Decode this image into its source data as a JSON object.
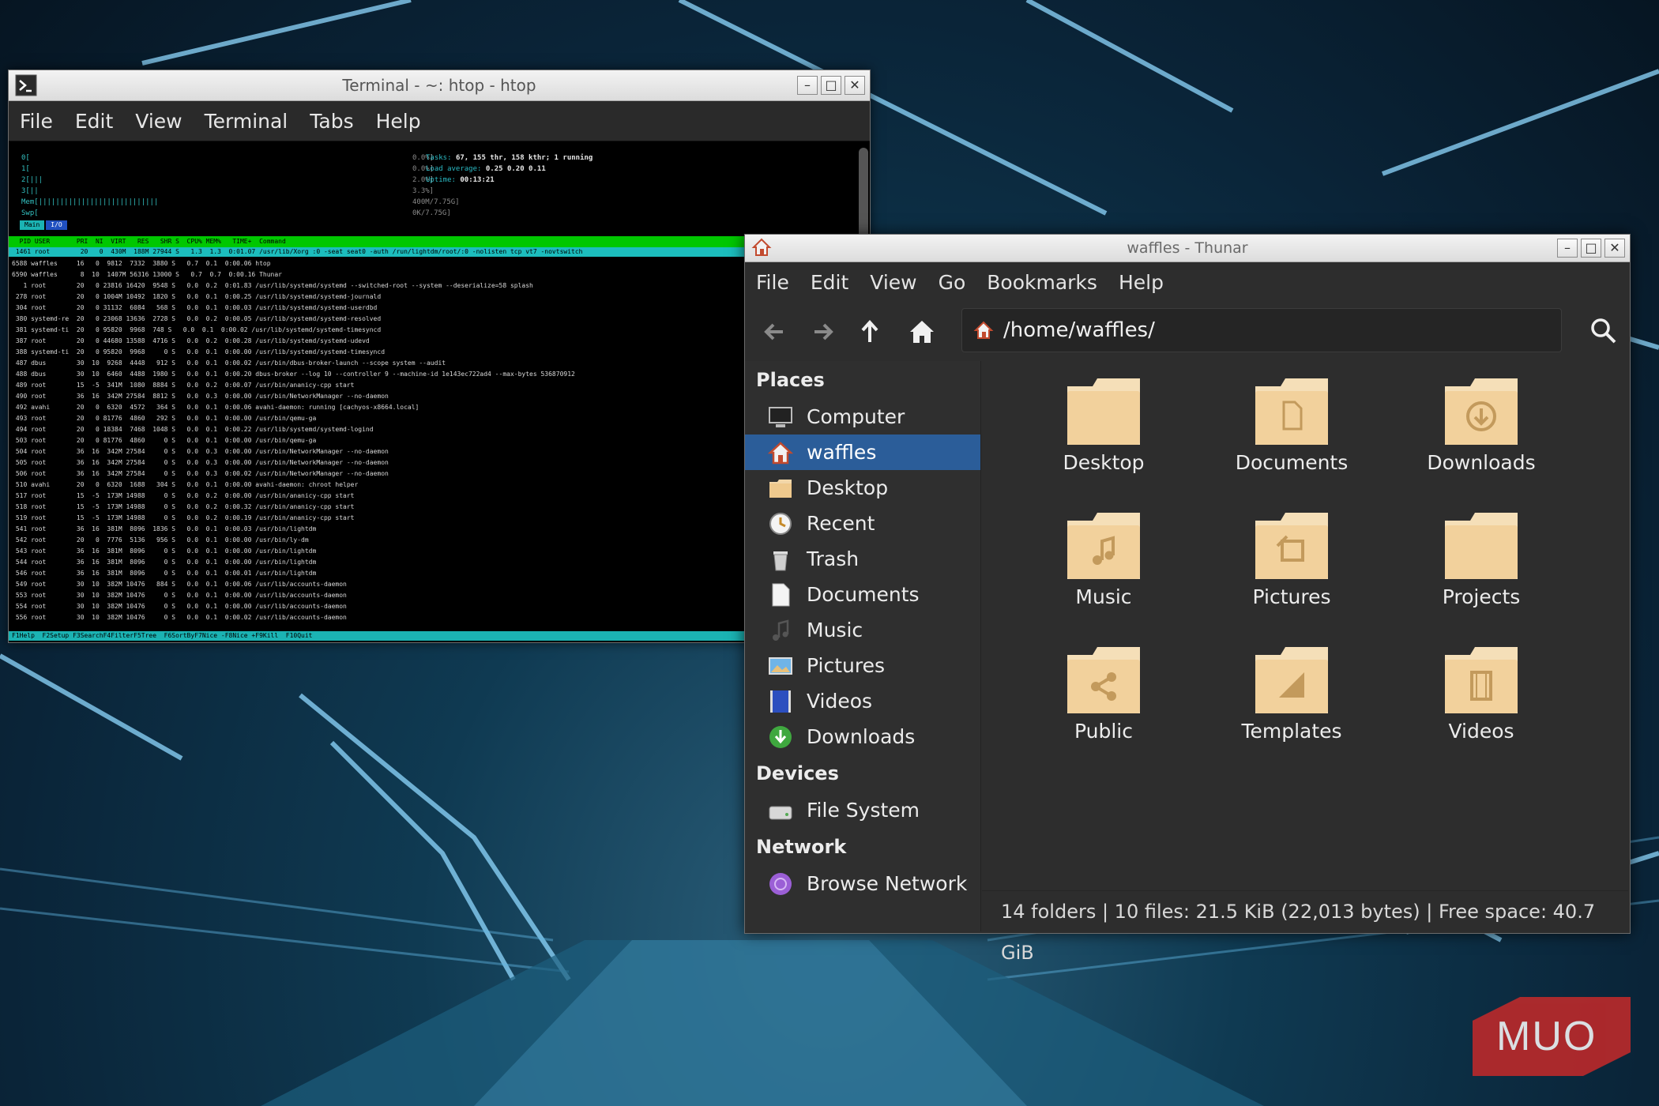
{
  "terminal": {
    "title": "Terminal - ~: htop - htop",
    "menu": [
      "File",
      "Edit",
      "View",
      "Terminal",
      "Tabs",
      "Help"
    ],
    "htop": {
      "meters": [
        {
          "label": "0[",
          "value": "0.0%]"
        },
        {
          "label": "1[",
          "value": "0.0%]"
        },
        {
          "label": "2[|||",
          "value": "2.0%]"
        },
        {
          "label": "3[||",
          "value": "3.3%]"
        },
        {
          "label": "Mem[||||||||||||||||||||||||||||",
          "value": "400M/7.75G]"
        },
        {
          "label": "Swp[",
          "value": "0K/7.75G]"
        }
      ],
      "tasks_label": "Tasks:",
      "tasks_value": "67, 155 thr, 158 kthr; 1 running",
      "load_label": "Load average:",
      "load_value": "0.25 0.20 0.11",
      "uptime_label": "Uptime:",
      "uptime_value": "00:13:21",
      "tab_main": "Main",
      "tab_io": "I/O",
      "header": "  PID USER       PRI  NI  VIRT   RES   SHR S  CPU% MEM%   TIME+  Command",
      "selected": " 1461 root        20   0  430M  188M 27944 S   1.3  1.3  0:01.07 /usr/lib/Xorg :0 -seat seat0 -auth /run/lightdm/root/:0 -nolisten tcp vt7 -novtswitch",
      "processes": [
        "6588 waffles     16   0  9812  7332  3880 S   0.7  0.1  0:00.06 htop",
        "6590 waffles      8  10  1407M 56316 13000 S   0.7  0.7  0:00.16 Thunar",
        "   1 root        20   0 23816 16420  9548 S   0.0  0.2  0:01.83 /usr/lib/systemd/systemd --switched-root --system --deserialize=58 splash",
        " 278 root        20   0 1004M 10492  1820 S   0.0  0.1  0:00.25 /usr/lib/systemd/systemd-journald",
        " 304 root        20   0 31132  6084   568 S   0.0  0.1  0:00.03 /usr/lib/systemd/systemd-userdbd",
        " 380 systemd-re  20   0 23068 13636  2728 S   0.0  0.2  0:00.05 /usr/lib/systemd/systemd-resolved",
        " 381 systemd-ti  20   0 95820  9968  748 S   0.0  0.1  0:00.02 /usr/lib/systemd/systemd-timesyncd",
        " 387 root        20   0 44680 13588  4716 S   0.0  0.2  0:00.28 /usr/lib/systemd/systemd-udevd",
        " 388 systemd-ti  20   0 95820  9968     0 S   0.0  0.1  0:00.00 /usr/lib/systemd/systemd-timesyncd",
        " 487 dbus        30  10  9268  4448   912 S   0.0  0.1  0:00.02 /usr/bin/dbus-broker-launch --scope system --audit",
        " 488 dbus        30  10  6460  4488  1980 S   0.0  0.1  0:00.20 dbus-broker --log 10 --controller 9 --machine-id 1e143ec722ad4 --max-bytes 536870912",
        " 489 root        15  -5  341M  1080  8884 S   0.0  0.2  0:00.07 /usr/bin/ananicy-cpp start",
        " 490 root        36  16  342M 27584  8812 S   0.0  0.3  0:00.00 /usr/bin/NetworkManager --no-daemon",
        " 492 avahi       20   0  6320  4572   364 S   0.0  0.1  0:00.06 avahi-daemon: running [cachyos-x8664.local]",
        " 493 root        20   0 81776  4860   292 S   0.0  0.1  0:00.00 /usr/bin/qemu-ga",
        " 494 root        20   0 18384  7468  1048 S   0.0  0.1  0:00.22 /usr/lib/systemd/systemd-logind",
        " 503 root        20   0 81776  4860     0 S   0.0  0.1  0:00.00 /usr/bin/qemu-ga",
        " 504 root        36  16  342M 27584     0 S   0.0  0.3  0:00.00 /usr/bin/NetworkManager --no-daemon",
        " 505 root        36  16  342M 27584     0 S   0.0  0.3  0:00.00 /usr/bin/NetworkManager --no-daemon",
        " 506 root        36  16  342M 27584     0 S   0.0  0.3  0:00.02 /usr/bin/NetworkManager --no-daemon",
        " 510 avahi       20   0  6320  1688   304 S   0.0  0.1  0:00.00 avahi-daemon: chroot helper",
        " 517 root        15  -5  173M 14988     0 S   0.0  0.2  0:00.00 /usr/bin/ananicy-cpp start",
        " 518 root        15  -5  173M 14988     0 S   0.0  0.2  0:00.32 /usr/bin/ananicy-cpp start",
        " 519 root        15  -5  173M 14988     0 S   0.0  0.2  0:00.19 /usr/bin/ananicy-cpp start",
        " 541 root        36  16  381M  8096  1836 S   0.0  0.1  0:00.03 /usr/bin/lightdm",
        " 542 root        20   0  7776  5136   956 S   0.0  0.1  0:00.00 /usr/bin/ly-dm",
        " 543 root        36  16  381M  8096     0 S   0.0  0.1  0:00.00 /usr/bin/lightdm",
        " 544 root        36  16  381M  8096     0 S   0.0  0.1  0:00.00 /usr/bin/lightdm",
        " 546 root        36  16  381M  8096     0 S   0.0  0.1  0:00.01 /usr/bin/lightdm",
        " 549 root        30  10  382M 10476   884 S   0.0  0.1  0:00.06 /usr/lib/accounts-daemon",
        " 553 root        30  10  382M 10476     0 S   0.0  0.1  0:00.00 /usr/lib/accounts-daemon",
        " 554 root        30  10  382M 10476     0 S   0.0  0.1  0:00.00 /usr/lib/accounts-daemon",
        " 556 root        30  10  382M 10476     0 S   0.0  0.1  0:00.02 /usr/lib/accounts-daemon"
      ],
      "fkeys": "F1Help  F2Setup F3SearchF4FilterF5Tree  F6SortByF7Nice -F8Nice +F9Kill  F10Quit"
    }
  },
  "thunar": {
    "title": "waffles - Thunar",
    "menu": [
      "File",
      "Edit",
      "View",
      "Go",
      "Bookmarks",
      "Help"
    ],
    "path": "/home/waffles/",
    "sidebar": {
      "places_heading": "Places",
      "places": [
        {
          "label": "Computer",
          "icon": "computer-icon"
        },
        {
          "label": "waffles",
          "icon": "home-icon",
          "selected": true
        },
        {
          "label": "Desktop",
          "icon": "folder-icon"
        },
        {
          "label": "Recent",
          "icon": "recent-icon"
        },
        {
          "label": "Trash",
          "icon": "trash-icon"
        },
        {
          "label": "Documents",
          "icon": "document-icon"
        },
        {
          "label": "Music",
          "icon": "music-icon"
        },
        {
          "label": "Pictures",
          "icon": "pictures-icon"
        },
        {
          "label": "Videos",
          "icon": "videos-icon"
        },
        {
          "label": "Downloads",
          "icon": "downloads-icon"
        }
      ],
      "devices_heading": "Devices",
      "devices": [
        {
          "label": "File System",
          "icon": "drive-icon"
        }
      ],
      "network_heading": "Network",
      "network": [
        {
          "label": "Browse Network",
          "icon": "network-icon"
        }
      ]
    },
    "folders": [
      {
        "name": "Desktop",
        "emblem": "none"
      },
      {
        "name": "Documents",
        "emblem": "document"
      },
      {
        "name": "Downloads",
        "emblem": "download"
      },
      {
        "name": "Music",
        "emblem": "music"
      },
      {
        "name": "Pictures",
        "emblem": "picture"
      },
      {
        "name": "Projects",
        "emblem": "none"
      },
      {
        "name": "Public",
        "emblem": "share"
      },
      {
        "name": "Templates",
        "emblem": "template"
      },
      {
        "name": "Videos",
        "emblem": "video"
      }
    ],
    "status": "14 folders  |  10 files: 21.5 KiB (22,013 bytes)  |  Free space: 40.7 GiB"
  },
  "watermark": "MUO",
  "colors": {
    "selection": "#2b5d99",
    "folder": "#f2d6a8",
    "htop_header": "#00c700",
    "htop_highlight": "#1bb3b3"
  }
}
